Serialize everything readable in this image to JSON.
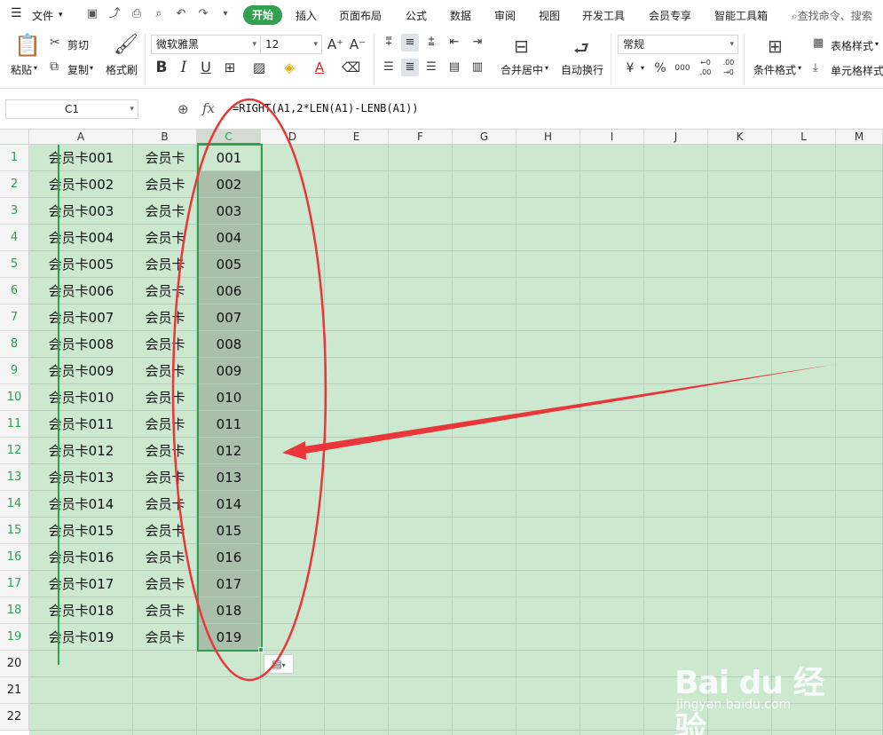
{
  "menubar": {
    "file_label": "文件",
    "tabs": [
      "开始",
      "插入",
      "页面布局",
      "公式",
      "数据",
      "审阅",
      "视图",
      "开发工具",
      "会员专享",
      "智能工具箱"
    ],
    "search_placeholder": "查找命令、搜索"
  },
  "ribbon": {
    "paste_label": "粘贴",
    "cut_label": "剪切",
    "copy_label": "复制",
    "format_painter_label": "格式刷",
    "font_name": "微软雅黑",
    "font_size": "12",
    "merge_center_label": "合并居中",
    "wrap_text_label": "自动换行",
    "number_format": "常规",
    "conditional_format_label": "条件格式",
    "table_style_label": "表格样式",
    "cell_style_label": "单元格样式",
    "bold": "B",
    "italic": "I",
    "underline": "U",
    "font_color_glyph": "A",
    "currency_glyph": "¥",
    "percent_glyph": "%",
    "thousands_glyph": "000",
    "inc_decimal_glyph": "←0 .00",
    "dec_decimal_glyph": ".00 →0",
    "font_grow_glyph": "A⁺",
    "font_shrink_glyph": "A⁻"
  },
  "formula_bar": {
    "name_box": "C1",
    "fx_label": "fx",
    "formula": "=RIGHT(A1,2*LEN(A1)-LENB(A1))"
  },
  "columns": [
    "A",
    "B",
    "C",
    "D",
    "E",
    "F",
    "G",
    "H",
    "I",
    "J",
    "K",
    "L",
    "M"
  ],
  "selected_column": "C",
  "rows": [
    {
      "n": "1",
      "a": "会员卡001",
      "b": "会员卡",
      "c": "001"
    },
    {
      "n": "2",
      "a": "会员卡002",
      "b": "会员卡",
      "c": "002"
    },
    {
      "n": "3",
      "a": "会员卡003",
      "b": "会员卡",
      "c": "003"
    },
    {
      "n": "4",
      "a": "会员卡004",
      "b": "会员卡",
      "c": "004"
    },
    {
      "n": "5",
      "a": "会员卡005",
      "b": "会员卡",
      "c": "005"
    },
    {
      "n": "6",
      "a": "会员卡006",
      "b": "会员卡",
      "c": "006"
    },
    {
      "n": "7",
      "a": "会员卡007",
      "b": "会员卡",
      "c": "007"
    },
    {
      "n": "8",
      "a": "会员卡008",
      "b": "会员卡",
      "c": "008"
    },
    {
      "n": "9",
      "a": "会员卡009",
      "b": "会员卡",
      "c": "009"
    },
    {
      "n": "10",
      "a": "会员卡010",
      "b": "会员卡",
      "c": "010"
    },
    {
      "n": "11",
      "a": "会员卡011",
      "b": "会员卡",
      "c": "011"
    },
    {
      "n": "12",
      "a": "会员卡012",
      "b": "会员卡",
      "c": "012"
    },
    {
      "n": "13",
      "a": "会员卡013",
      "b": "会员卡",
      "c": "013"
    },
    {
      "n": "14",
      "a": "会员卡014",
      "b": "会员卡",
      "c": "014"
    },
    {
      "n": "15",
      "a": "会员卡015",
      "b": "会员卡",
      "c": "015"
    },
    {
      "n": "16",
      "a": "会员卡016",
      "b": "会员卡",
      "c": "016"
    },
    {
      "n": "17",
      "a": "会员卡017",
      "b": "会员卡",
      "c": "017"
    },
    {
      "n": "18",
      "a": "会员卡018",
      "b": "会员卡",
      "c": "018"
    },
    {
      "n": "19",
      "a": "会员卡019",
      "b": "会员卡",
      "c": "019"
    },
    {
      "n": "20",
      "a": "",
      "b": "",
      "c": ""
    },
    {
      "n": "21",
      "a": "",
      "b": "",
      "c": ""
    },
    {
      "n": "22",
      "a": "",
      "b": "",
      "c": ""
    }
  ],
  "colors": {
    "accent_green": "#2fa14f",
    "sheet_background": "#cce8cf",
    "selection_fill": "#a9bfaa",
    "annotation_red": "#e8363a"
  },
  "watermark": {
    "main": "Bai du 经验",
    "sub": "jingyan.baidu.com"
  }
}
